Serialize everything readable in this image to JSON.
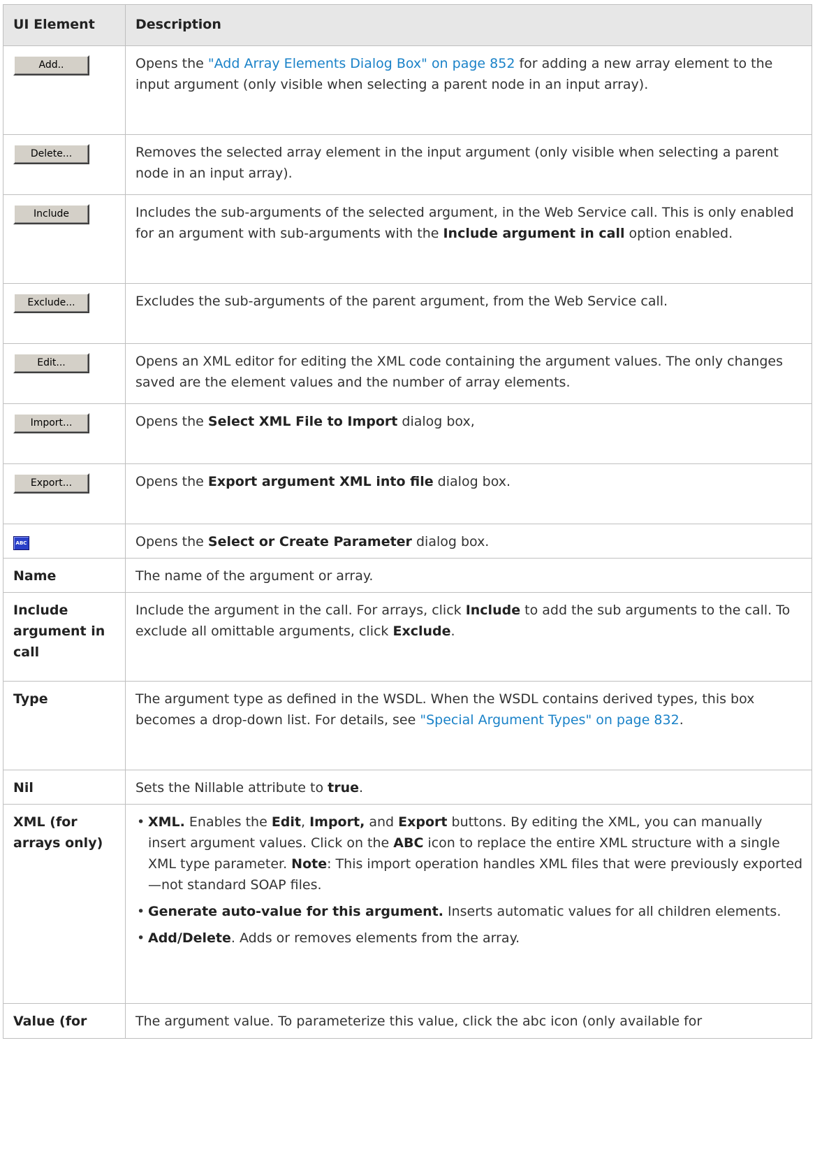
{
  "headers": {
    "col1": "UI Element",
    "col2": "Description"
  },
  "rows": {
    "add": {
      "button_label": "Add..",
      "d1": "Opens the ",
      "link": "\"Add Array Elements Dialog Box\" on page 852",
      "d2": " for adding a new array element to the input argument (only visible when selecting a parent node in an input array)."
    },
    "delete": {
      "button_label": "Delete...",
      "d1": "Removes the selected array element in the input argument (only visible when selecting a parent node in an input array)."
    },
    "include": {
      "button_label": "Include",
      "d1": "Includes the sub-arguments of the selected argument, in the Web Service call. This is only enabled for an argument with sub-arguments with the ",
      "b1": "Include argument in call",
      "d2": " option enabled."
    },
    "exclude": {
      "button_label": "Exclude...",
      "d1": "Excludes the sub-arguments of the parent argument, from the Web Service call."
    },
    "edit": {
      "button_label": "Edit...",
      "d1": "Opens an XML editor for editing the XML code containing the argument values. The only changes saved are the element values and the number of array elements."
    },
    "import": {
      "button_label": "Import...",
      "d1": "Opens the ",
      "b1": "Select XML File to Import",
      "d2": " dialog box,"
    },
    "export": {
      "button_label": "Export...",
      "d1": "Opens the ",
      "b1": "Export argument XML into file",
      "d2": " dialog box."
    },
    "abc": {
      "icon_label": "ABC",
      "d1": "Opens the ",
      "b1": "Select or Create Parameter",
      "d2": " dialog box."
    },
    "name": {
      "term": "Name",
      "d1": "The name of the argument or array."
    },
    "include_arg": {
      "term": "Include argument in call",
      "d1": "Include the argument in the call. For arrays, click ",
      "b1": "Include",
      "d2": " to add the sub arguments to the call. To exclude all omittable arguments, click ",
      "b2": "Exclude",
      "d3": "."
    },
    "type": {
      "term": "Type",
      "d1": "The argument type as defined in the WSDL. When the WSDL contains derived types, this box becomes a drop-down list. For details, see ",
      "link": "\"Special Argument Types\" on page 832",
      "d2": "."
    },
    "nil": {
      "term": "Nil",
      "d1": "Sets the Nillable attribute to ",
      "b1": "true",
      "d2": "."
    },
    "xml": {
      "term": "XML (for arrays only)",
      "bullets": [
        {
          "b1": "XML.",
          "t1": " Enables the ",
          "b2": "Edit",
          "t2": ", ",
          "b3": "Import,",
          "t3": " and ",
          "b4": "Export",
          "t4": " buttons. By editing the XML, you can manually insert argument values. Click on the ",
          "b5": "ABC",
          "t5": " icon to replace the entire XML structure with a single XML type parameter. ",
          "b6": "Note",
          "t6": ": This import operation handles XML files that were previously exported—not standard SOAP files."
        },
        {
          "b1": "Generate auto-value for this argument.",
          "t1": " Inserts automatic values for all children elements."
        },
        {
          "b1": "Add/Delete",
          "t1": ". Adds or removes elements from the array."
        }
      ]
    },
    "value": {
      "term": "Value (for",
      "d1": "The argument value. To parameterize this value, click the abc icon (only available for"
    }
  }
}
